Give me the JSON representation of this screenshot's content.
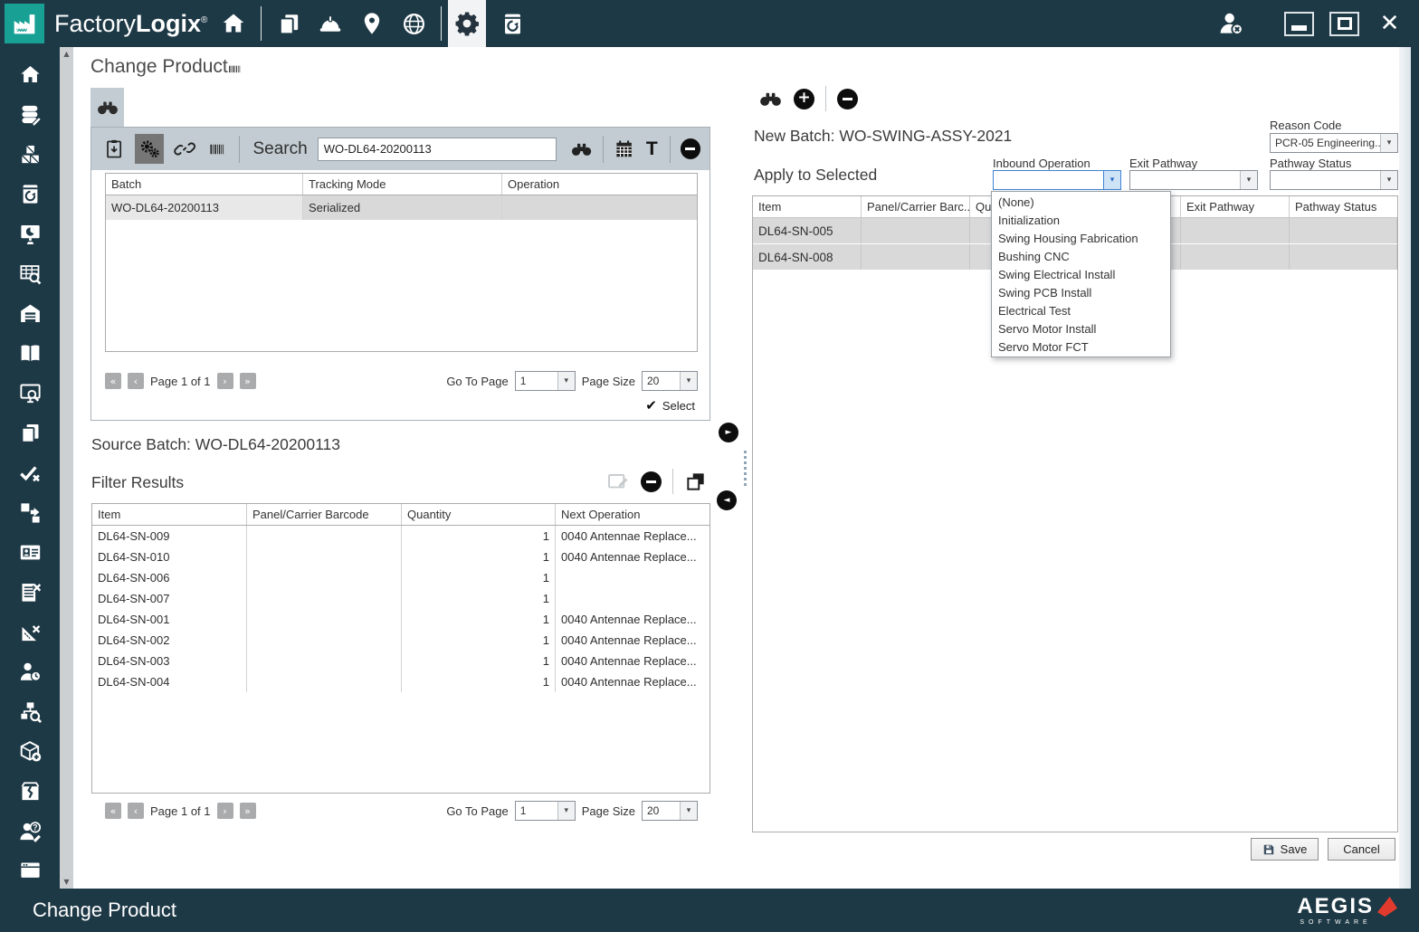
{
  "titlebar": {
    "brand_light": "Factory",
    "brand_bold": "Logix",
    "registered": "®"
  },
  "page": {
    "title": "Change Product"
  },
  "search_panel": {
    "search_label": "Search",
    "search_value": "WO-DL64-20200113",
    "columns": [
      "Batch",
      "Tracking Mode",
      "Operation"
    ],
    "rows": [
      {
        "batch": "WO-DL64-20200113",
        "tracking_mode": "Serialized",
        "operation": ""
      }
    ],
    "pagination": {
      "page_text": "Page 1 of 1",
      "goto_label": "Go To Page",
      "goto_value": "1",
      "size_label": "Page Size",
      "size_value": "20"
    },
    "select_label": "Select",
    "toolbar_text_icon": "T"
  },
  "source_batch": {
    "label": "Source Batch:",
    "value": "WO-DL64-20200113"
  },
  "filter_results": {
    "title": "Filter Results",
    "columns": [
      "Item",
      "Panel/Carrier Barcode",
      "Quantity",
      "Next Operation"
    ],
    "rows": [
      {
        "item": "DL64-SN-009",
        "panel_barcode": "",
        "quantity": "1",
        "next_operation": "0040 Antennae Replace..."
      },
      {
        "item": "DL64-SN-010",
        "panel_barcode": "",
        "quantity": "1",
        "next_operation": "0040 Antennae Replace..."
      },
      {
        "item": "DL64-SN-006",
        "panel_barcode": "",
        "quantity": "1",
        "next_operation": ""
      },
      {
        "item": "DL64-SN-007",
        "panel_barcode": "",
        "quantity": "1",
        "next_operation": ""
      },
      {
        "item": "DL64-SN-001",
        "panel_barcode": "",
        "quantity": "1",
        "next_operation": "0040 Antennae Replace..."
      },
      {
        "item": "DL64-SN-002",
        "panel_barcode": "",
        "quantity": "1",
        "next_operation": "0040 Antennae Replace..."
      },
      {
        "item": "DL64-SN-003",
        "panel_barcode": "",
        "quantity": "1",
        "next_operation": "0040 Antennae Replace..."
      },
      {
        "item": "DL64-SN-004",
        "panel_barcode": "",
        "quantity": "1",
        "next_operation": "0040 Antennae Replace..."
      }
    ],
    "pagination": {
      "page_text": "Page 1 of 1",
      "goto_label": "Go To Page",
      "goto_value": "1",
      "size_label": "Page Size",
      "size_value": "20"
    }
  },
  "right_panel": {
    "new_batch_label": "New Batch:",
    "new_batch_value": "WO-SWING-ASSY-2021",
    "apply_label": "Apply to Selected",
    "reason_code": {
      "label": "Reason Code",
      "value": "PCR-05 Engineering..."
    },
    "inbound_operation": {
      "label": "Inbound Operation",
      "value": ""
    },
    "exit_pathway": {
      "label": "Exit Pathway",
      "value": ""
    },
    "pathway_status": {
      "label": "Pathway Status",
      "value": ""
    },
    "inbound_dropdown_options": [
      "(None)",
      "Initialization",
      "Swing Housing Fabrication",
      "Bushing CNC",
      "Swing Electrical Install",
      "Swing PCB Install",
      "Electrical Test",
      "Servo Motor Install",
      "Servo Motor FCT"
    ],
    "columns": [
      "Item",
      "Panel/Carrier Barc...",
      "Qua...",
      "",
      "Exit Pathway",
      "Pathway Status"
    ],
    "rows": [
      {
        "item": "DL64-SN-005"
      },
      {
        "item": "DL64-SN-008"
      }
    ],
    "save_label": "Save",
    "cancel_label": "Cancel"
  },
  "footer": {
    "title": "Change Product",
    "logo_text": "AEGIS",
    "logo_subtext": "SOFTWARE"
  },
  "icons": {
    "topbar": [
      "factorylogix-logo",
      "home",
      "copy-pages",
      "hard-hat",
      "location-pin",
      "globe",
      "settings-gear",
      "batch-restore",
      "user-logout",
      "minimize",
      "maximize",
      "close"
    ],
    "sidebar": [
      "home",
      "data-editor",
      "materials",
      "batch-restore",
      "dashboard",
      "data-query",
      "warehouse",
      "documentation",
      "review-search",
      "copy",
      "validate",
      "transfer",
      "id-badge",
      "list-remove",
      "measure-remove",
      "operator-time",
      "hierarchy-search",
      "package-add",
      "package-damage",
      "operator-question",
      "terminal"
    ]
  },
  "colors": {
    "topbar": "#1e3946",
    "accent_teal": "#18a095",
    "panel_header": "#c3ccd2",
    "selected_row": "#d9d9d9",
    "focus_blue": "#3f83d2",
    "logo_red": "#e23b2e"
  }
}
